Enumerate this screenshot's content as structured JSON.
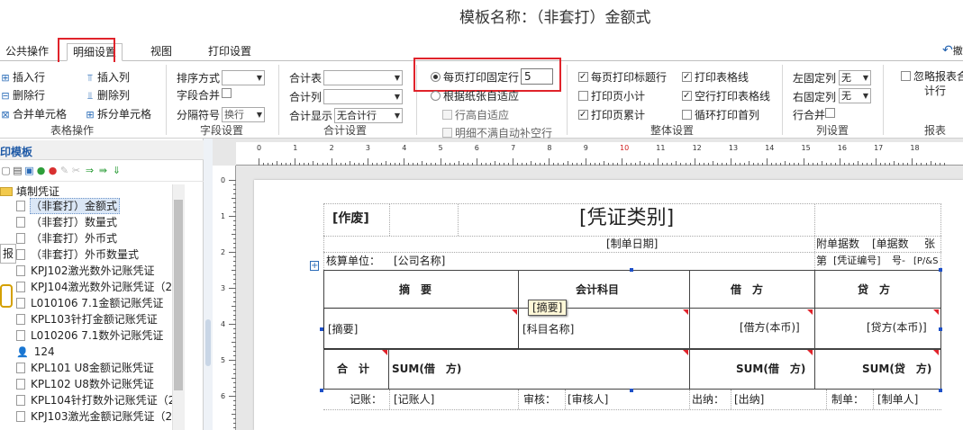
{
  "title": "模板名称：（非套打）金额式",
  "tabs": [
    {
      "label": "公共操作"
    },
    {
      "label": "明细设置"
    },
    {
      "label": "视图"
    },
    {
      "label": "打印设置"
    }
  ],
  "undo_label": "撤",
  "ribbon": {
    "table_ops": {
      "insert_row": "插入行",
      "delete_row": "删除行",
      "merge_cells": "合并单元格",
      "insert_col": "插入列",
      "delete_col": "删除列",
      "split_cells": "拆分单元格",
      "caption": "表格操作"
    },
    "field_settings": {
      "sort_label": "排序方式",
      "sort_value": "",
      "merge_label": "字段合并",
      "sep_label": "分隔符号",
      "sep_value": "换行",
      "caption": "字段设置"
    },
    "total_settings": {
      "total_table_label": "合计表",
      "total_table_value": "",
      "total_col_label": "合计列",
      "total_col_value": "",
      "total_display_label": "合计显示",
      "total_display_value": "无合计行",
      "caption": "合计设置"
    },
    "print_rows": {
      "fixed_rows_label": "每页打印固定行",
      "fixed_rows_value": "5",
      "adaptive_label": "根据纸张自适应",
      "row_height_label": "行高自适应",
      "no_fill_label": "明细不满自动补空行"
    },
    "overall": {
      "print_header": "每页打印标题行",
      "print_table_lines": "打印表格线",
      "print_subtotal": "打印页小计",
      "empty_row_lines": "空行打印表格线",
      "print_cumulative": "打印页累计",
      "loop_first_col": "循环打印首列",
      "caption": "整体设置"
    },
    "columns": {
      "left_fixed_label": "左固定列",
      "left_fixed_value": "无",
      "right_fixed_label": "右固定列",
      "right_fixed_value": "无",
      "row_merge_label": "行合并",
      "caption": "列设置"
    },
    "report": {
      "ignore_label": "忽略报表合",
      "ignore_label_2": "计行",
      "caption": "报表"
    }
  },
  "left_panel": {
    "title": "印模板",
    "folder": "填制凭证",
    "side_tab": "报",
    "items": [
      "（非套打）金额式",
      "（非套打）数量式",
      "（非套打）外币式",
      "（非套打）外币数量式",
      "KPJ102激光数外记账凭证",
      "KPJ104激光数外记账凭证（2",
      "L010106 7.1金额记账凭证",
      "KPL103针打金额记账凭证",
      "L010206 7.1数外记账凭证",
      "124",
      "KPL101 U8金额记账凭证",
      "KPL102 U8数外记账凭证",
      "KPL104针打数外记账凭证（2",
      "KPJ103激光金额记账凭证（2"
    ]
  },
  "rulers": {
    "h": [
      "0",
      "1",
      "2",
      "3",
      "4",
      "5",
      "6",
      "7",
      "8",
      "9",
      "10",
      "11",
      "12",
      "13",
      "14",
      "15",
      "16",
      "17",
      "18"
    ],
    "v": [
      "0",
      "1",
      "2",
      "3",
      "4",
      "5",
      "6"
    ]
  },
  "voucher": {
    "void": "[作废]",
    "type": "[凭证类别]",
    "date": "[制单日期]",
    "attach_label": "附单据数",
    "attach_value": "[单据数",
    "attach_unit": "张",
    "unit_label": "核算单位：",
    "company": "[公司名称]",
    "number_label": "第",
    "number_value": "[凭证编号]",
    "number_suffix": "号-",
    "page_value": "[P/&S",
    "h_summary": "摘　要",
    "h_account": "会计科目",
    "h_debit": "借　方",
    "h_credit": "贷　方",
    "r_summary": "[摘要]",
    "r_account": "[科目名称]",
    "r_debit": "[借方(本币)]",
    "r_credit": "[贷方(本币)]",
    "total_label": "合　计",
    "sum_debit_text": "SUM(借　方)",
    "sum_debit": "SUM(借　方)",
    "sum_credit": "SUM(贷　方)",
    "bookkeeper_label": "记账：",
    "bookkeeper": "[记账人]",
    "auditor_label": "审核：",
    "auditor": "[审核人]",
    "cashier_label": "出纳：",
    "cashier": "[出纳]",
    "maker_label": "制单：",
    "maker": "[制单人]",
    "tooltip": "[摘要]"
  }
}
